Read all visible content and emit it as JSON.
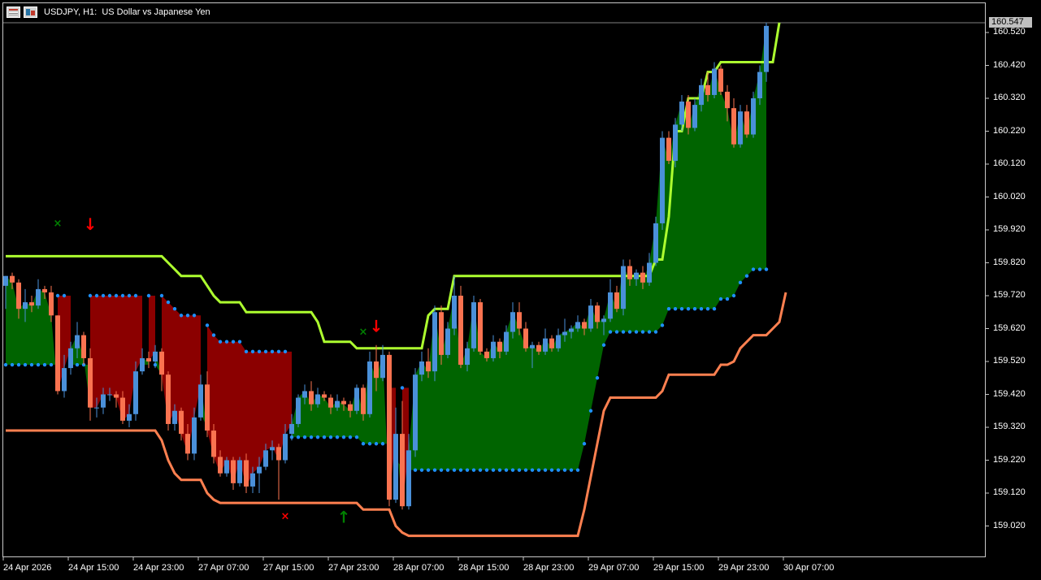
{
  "window": {
    "title": "USDJPY, H1:  US Dollar vs Japanese Yen",
    "icons": [
      "chart-window-icon",
      "chart-type-icon"
    ]
  },
  "colors": {
    "background": "#000000",
    "bull_candle": "#4a90d9",
    "bear_candle": "#fa7350",
    "upper_band": "#adff2f",
    "lower_band": "#ff8050",
    "dots": "#1e90ff",
    "fill_bull": "#006400",
    "fill_bear": "#8b0000",
    "buy_arrow": "#008000",
    "sell_arrow": "#ff0000"
  },
  "price_axis": {
    "labels": [
      "160.520",
      "160.420",
      "160.320",
      "160.220",
      "160.120",
      "160.020",
      "159.920",
      "159.820",
      "159.720",
      "159.620",
      "159.520",
      "159.420",
      "159.320",
      "159.220",
      "159.120",
      "159.020"
    ],
    "current_price": "160.547"
  },
  "time_axis": {
    "labels": [
      "24 Apr 2026",
      "24 Apr 15:00",
      "24 Apr 23:00",
      "27 Apr 07:00",
      "27 Apr 15:00",
      "27 Apr 23:00",
      "28 Apr 07:00",
      "28 Apr 15:00",
      "28 Apr 23:00",
      "29 Apr 07:00",
      "29 Apr 15:00",
      "29 Apr 23:00",
      "30 Apr 07:00"
    ]
  },
  "chart_data": {
    "type": "candlestick",
    "symbol": "USDJPY",
    "timeframe": "H1",
    "ylim": [
      158.95,
      160.56
    ],
    "candles": [
      [
        159.75,
        159.78,
        159.68,
        159.78
      ],
      [
        159.78,
        159.79,
        159.74,
        159.76
      ],
      [
        159.76,
        159.77,
        159.65,
        159.68
      ],
      [
        159.68,
        159.74,
        159.64,
        159.7
      ],
      [
        159.7,
        159.72,
        159.67,
        159.69
      ],
      [
        159.69,
        159.77,
        159.68,
        159.74
      ],
      [
        159.74,
        159.75,
        159.71,
        159.73
      ],
      [
        159.73,
        159.75,
        159.64,
        159.66
      ],
      [
        159.66,
        159.66,
        159.42,
        159.43
      ],
      [
        159.43,
        159.54,
        159.41,
        159.5
      ],
      [
        159.5,
        159.58,
        159.48,
        159.56
      ],
      [
        159.56,
        159.64,
        159.53,
        159.6
      ],
      [
        159.6,
        159.61,
        159.51,
        159.53
      ],
      [
        159.53,
        159.56,
        159.34,
        159.38
      ],
      [
        159.38,
        159.41,
        159.35,
        159.38
      ],
      [
        159.38,
        159.44,
        159.36,
        159.42
      ],
      [
        159.42,
        159.44,
        159.4,
        159.42
      ],
      [
        159.42,
        159.43,
        159.38,
        159.41
      ],
      [
        159.41,
        159.43,
        159.33,
        159.34
      ],
      [
        159.34,
        159.39,
        159.32,
        159.36
      ],
      [
        159.36,
        159.52,
        159.34,
        159.49
      ],
      [
        159.49,
        159.56,
        159.48,
        159.53
      ],
      [
        159.53,
        159.55,
        159.5,
        159.52
      ],
      [
        159.52,
        159.57,
        159.5,
        159.55
      ],
      [
        159.55,
        159.56,
        159.43,
        159.48
      ],
      [
        159.48,
        159.49,
        159.31,
        159.33
      ],
      [
        159.33,
        159.39,
        159.31,
        159.37
      ],
      [
        159.37,
        159.38,
        159.28,
        159.3
      ],
      [
        159.3,
        159.33,
        159.22,
        159.24
      ],
      [
        159.24,
        159.38,
        159.22,
        159.35
      ],
      [
        159.35,
        159.48,
        159.34,
        159.45
      ],
      [
        159.45,
        159.49,
        159.29,
        159.31
      ],
      [
        159.31,
        159.33,
        159.21,
        159.23
      ],
      [
        159.23,
        159.25,
        159.17,
        159.18
      ],
      [
        159.18,
        159.23,
        159.17,
        159.22
      ],
      [
        159.22,
        159.23,
        159.13,
        159.15
      ],
      [
        159.15,
        159.23,
        159.14,
        159.22
      ],
      [
        159.22,
        159.24,
        159.12,
        159.14
      ],
      [
        159.14,
        159.2,
        159.12,
        159.18
      ],
      [
        159.18,
        159.23,
        159.12,
        159.2
      ],
      [
        159.2,
        159.27,
        159.19,
        159.25
      ],
      [
        159.25,
        159.28,
        159.22,
        159.26
      ],
      [
        159.26,
        159.27,
        159.1,
        159.22
      ],
      [
        159.22,
        159.33,
        159.21,
        159.3
      ],
      [
        159.3,
        159.36,
        159.28,
        159.33
      ],
      [
        159.33,
        159.42,
        159.32,
        159.41
      ],
      [
        159.41,
        159.45,
        159.39,
        159.43
      ],
      [
        159.43,
        159.46,
        159.37,
        159.39
      ],
      [
        159.39,
        159.44,
        159.38,
        159.42
      ],
      [
        159.42,
        159.43,
        159.4,
        159.41
      ],
      [
        159.41,
        159.42,
        159.36,
        159.38
      ],
      [
        159.38,
        159.42,
        159.37,
        159.4
      ],
      [
        159.4,
        159.41,
        159.37,
        159.39
      ],
      [
        159.39,
        159.4,
        159.35,
        159.37
      ],
      [
        159.37,
        159.45,
        159.36,
        159.44
      ],
      [
        159.44,
        159.45,
        159.34,
        159.36
      ],
      [
        159.36,
        159.55,
        159.35,
        159.52
      ],
      [
        159.52,
        159.57,
        159.43,
        159.47
      ],
      [
        159.47,
        159.57,
        159.46,
        159.54
      ],
      [
        159.54,
        159.55,
        159.08,
        159.1
      ],
      [
        159.1,
        159.38,
        159.09,
        159.3
      ],
      [
        159.3,
        159.4,
        159.07,
        159.08
      ],
      [
        159.08,
        159.3,
        159.07,
        159.25
      ],
      [
        159.25,
        159.5,
        159.23,
        159.48
      ],
      [
        159.48,
        159.55,
        159.46,
        159.52
      ],
      [
        159.52,
        159.56,
        159.47,
        159.49
      ],
      [
        159.49,
        159.69,
        159.46,
        159.67
      ],
      [
        159.67,
        159.69,
        159.51,
        159.54
      ],
      [
        159.54,
        159.64,
        159.53,
        159.62
      ],
      [
        159.62,
        159.78,
        159.6,
        159.72
      ],
      [
        159.72,
        159.75,
        159.5,
        159.51
      ],
      [
        159.51,
        159.58,
        159.49,
        159.56
      ],
      [
        159.56,
        159.72,
        159.55,
        159.7
      ],
      [
        159.7,
        159.71,
        159.54,
        159.55
      ],
      [
        159.55,
        159.56,
        159.52,
        159.53
      ],
      [
        159.53,
        159.6,
        159.52,
        159.58
      ],
      [
        159.58,
        159.59,
        159.53,
        159.55
      ],
      [
        159.55,
        159.63,
        159.54,
        159.61
      ],
      [
        159.61,
        159.7,
        159.59,
        159.67
      ],
      [
        159.67,
        159.7,
        159.6,
        159.62
      ],
      [
        159.62,
        159.64,
        159.55,
        159.56
      ],
      [
        159.56,
        159.58,
        159.5,
        159.57
      ],
      [
        159.57,
        159.58,
        159.54,
        159.55
      ],
      [
        159.55,
        159.62,
        159.54,
        159.59
      ],
      [
        159.59,
        159.6,
        159.55,
        159.56
      ],
      [
        159.56,
        159.62,
        159.55,
        159.6
      ],
      [
        159.6,
        159.65,
        159.58,
        159.61
      ],
      [
        159.61,
        159.63,
        159.59,
        159.62
      ],
      [
        159.62,
        159.66,
        159.61,
        159.64
      ],
      [
        159.64,
        159.65,
        159.6,
        159.62
      ],
      [
        159.62,
        159.71,
        159.61,
        159.69
      ],
      [
        159.69,
        159.7,
        159.62,
        159.64
      ],
      [
        159.64,
        159.66,
        159.6,
        159.65
      ],
      [
        159.65,
        159.77,
        159.64,
        159.73
      ],
      [
        159.73,
        159.75,
        159.67,
        159.68
      ],
      [
        159.68,
        159.83,
        159.66,
        159.81
      ],
      [
        159.81,
        159.83,
        159.75,
        159.77
      ],
      [
        159.77,
        159.8,
        159.75,
        159.79
      ],
      [
        159.79,
        159.81,
        159.74,
        159.76
      ],
      [
        159.76,
        159.85,
        159.75,
        159.82
      ],
      [
        159.82,
        159.96,
        159.81,
        159.94
      ],
      [
        159.94,
        160.22,
        159.92,
        160.2
      ],
      [
        160.2,
        160.22,
        160.12,
        160.13
      ],
      [
        160.13,
        160.26,
        160.11,
        160.24
      ],
      [
        160.24,
        160.33,
        160.22,
        160.31
      ],
      [
        160.31,
        160.33,
        160.21,
        160.23
      ],
      [
        160.23,
        160.32,
        160.22,
        160.3
      ],
      [
        160.3,
        160.38,
        160.28,
        160.36
      ],
      [
        160.36,
        160.4,
        160.31,
        160.33
      ],
      [
        160.33,
        160.43,
        160.32,
        160.41
      ],
      [
        160.41,
        160.42,
        160.33,
        160.34
      ],
      [
        160.34,
        160.36,
        160.25,
        160.29
      ],
      [
        160.29,
        160.32,
        160.17,
        160.18
      ],
      [
        160.18,
        160.3,
        160.17,
        160.28
      ],
      [
        160.28,
        160.3,
        160.2,
        160.21
      ],
      [
        160.21,
        160.34,
        160.2,
        160.32
      ],
      [
        160.32,
        160.42,
        160.3,
        160.4
      ],
      [
        160.4,
        160.55,
        160.37,
        160.54
      ]
    ],
    "upper_band": [
      159.84,
      159.84,
      159.84,
      159.84,
      159.84,
      159.84,
      159.84,
      159.84,
      159.84,
      159.84,
      159.84,
      159.84,
      159.84,
      159.84,
      159.84,
      159.84,
      159.84,
      159.84,
      159.84,
      159.84,
      159.84,
      159.84,
      159.84,
      159.84,
      159.84,
      159.82,
      159.8,
      159.78,
      159.78,
      159.78,
      159.78,
      159.75,
      159.72,
      159.7,
      159.7,
      159.7,
      159.7,
      159.67,
      159.67,
      159.67,
      159.67,
      159.67,
      159.67,
      159.67,
      159.67,
      159.67,
      159.67,
      159.67,
      159.64,
      159.58,
      159.58,
      159.58,
      159.58,
      159.58,
      159.56,
      159.56,
      159.56,
      159.56,
      159.56,
      159.56,
      159.56,
      159.56,
      159.56,
      159.56,
      159.56,
      159.66,
      159.68,
      159.68,
      159.68,
      159.78,
      159.78,
      159.78,
      159.78,
      159.78,
      159.78,
      159.78,
      159.78,
      159.78,
      159.78,
      159.78,
      159.78,
      159.78,
      159.78,
      159.78,
      159.78,
      159.78,
      159.78,
      159.78,
      159.78,
      159.78,
      159.78,
      159.78,
      159.78,
      159.78,
      159.78,
      159.78,
      159.78,
      159.78,
      159.78,
      159.78,
      159.83,
      159.83,
      159.96,
      160.22,
      160.22,
      160.32,
      160.32,
      160.32,
      160.4,
      160.4,
      160.43,
      160.43,
      160.43,
      160.43,
      160.43,
      160.43,
      160.43,
      160.43,
      160.43,
      160.55
    ],
    "lower_band": [
      159.31,
      159.31,
      159.31,
      159.31,
      159.31,
      159.31,
      159.31,
      159.31,
      159.31,
      159.31,
      159.31,
      159.31,
      159.31,
      159.31,
      159.31,
      159.31,
      159.31,
      159.31,
      159.31,
      159.31,
      159.31,
      159.31,
      159.31,
      159.31,
      159.28,
      159.22,
      159.18,
      159.16,
      159.16,
      159.16,
      159.16,
      159.12,
      159.1,
      159.09,
      159.09,
      159.09,
      159.09,
      159.09,
      159.09,
      159.09,
      159.09,
      159.09,
      159.09,
      159.09,
      159.09,
      159.09,
      159.09,
      159.09,
      159.09,
      159.09,
      159.09,
      159.09,
      159.09,
      159.09,
      159.09,
      159.07,
      159.07,
      159.07,
      159.07,
      159.07,
      159.02,
      159.0,
      158.99,
      158.99,
      158.99,
      158.99,
      158.99,
      158.99,
      158.99,
      158.99,
      158.99,
      158.99,
      158.99,
      158.99,
      158.99,
      158.99,
      158.99,
      158.99,
      158.99,
      158.99,
      158.99,
      158.99,
      158.99,
      158.99,
      158.99,
      158.99,
      158.99,
      158.99,
      158.99,
      159.07,
      159.17,
      159.27,
      159.37,
      159.41,
      159.41,
      159.41,
      159.41,
      159.41,
      159.41,
      159.41,
      159.41,
      159.43,
      159.48,
      159.48,
      159.48,
      159.48,
      159.48,
      159.48,
      159.48,
      159.48,
      159.51,
      159.51,
      159.52,
      159.56,
      159.58,
      159.6,
      159.6,
      159.6,
      159.62,
      159.64,
      159.73
    ]
  },
  "signals": [
    {
      "type": "exit-buy",
      "marker": "×",
      "index": 8,
      "price": 159.93
    },
    {
      "type": "sell",
      "marker": "↓",
      "index": 13,
      "price": 159.92
    },
    {
      "type": "exit-sell",
      "marker": "×",
      "index": 43,
      "price": 159.04
    },
    {
      "type": "buy",
      "marker": "↑",
      "index": 52,
      "price": 159.03
    },
    {
      "type": "exit-buy",
      "marker": "×",
      "index": 55,
      "price": 159.6
    },
    {
      "type": "sell",
      "marker": "↓",
      "index": 57,
      "price": 159.61
    }
  ]
}
